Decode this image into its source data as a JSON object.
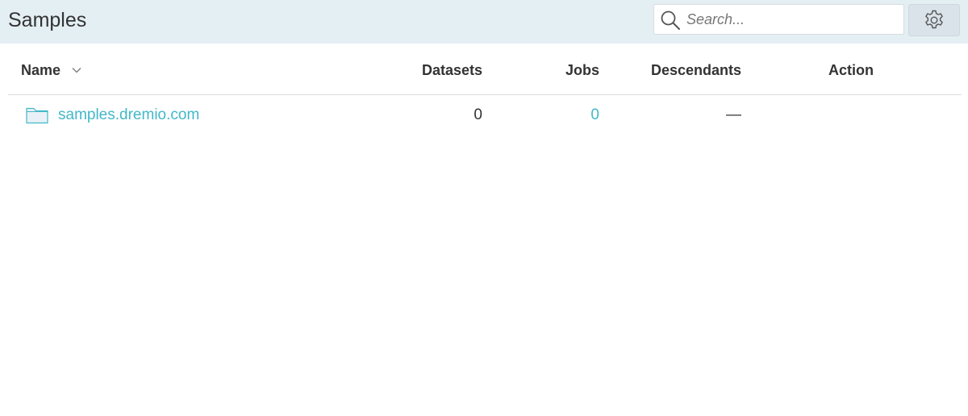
{
  "header": {
    "title": "Samples",
    "search": {
      "placeholder": "Search...",
      "value": ""
    },
    "settings_icon": "gear-icon"
  },
  "table": {
    "columns": {
      "name": "Name",
      "datasets": "Datasets",
      "jobs": "Jobs",
      "descendants": "Descendants",
      "action": "Action"
    },
    "sort_icon": "chevron-down-icon",
    "rows": [
      {
        "icon": "folder-icon",
        "name": "samples.dremio.com",
        "datasets": "0",
        "jobs": "0",
        "descendants": "—",
        "action": ""
      }
    ]
  },
  "colors": {
    "header_bg": "#e4eff4",
    "link": "#43b8c9",
    "text": "#333333"
  }
}
